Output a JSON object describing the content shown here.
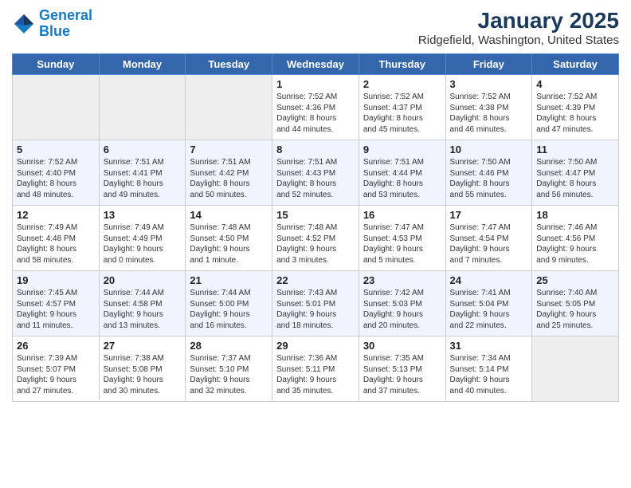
{
  "logo": {
    "line1": "General",
    "line2": "Blue"
  },
  "title": "January 2025",
  "subtitle": "Ridgefield, Washington, United States",
  "days_of_week": [
    "Sunday",
    "Monday",
    "Tuesday",
    "Wednesday",
    "Thursday",
    "Friday",
    "Saturday"
  ],
  "weeks": [
    {
      "days": [
        {
          "num": "",
          "info": ""
        },
        {
          "num": "",
          "info": ""
        },
        {
          "num": "",
          "info": ""
        },
        {
          "num": "1",
          "info": "Sunrise: 7:52 AM\nSunset: 4:36 PM\nDaylight: 8 hours\nand 44 minutes."
        },
        {
          "num": "2",
          "info": "Sunrise: 7:52 AM\nSunset: 4:37 PM\nDaylight: 8 hours\nand 45 minutes."
        },
        {
          "num": "3",
          "info": "Sunrise: 7:52 AM\nSunset: 4:38 PM\nDaylight: 8 hours\nand 46 minutes."
        },
        {
          "num": "4",
          "info": "Sunrise: 7:52 AM\nSunset: 4:39 PM\nDaylight: 8 hours\nand 47 minutes."
        }
      ]
    },
    {
      "days": [
        {
          "num": "5",
          "info": "Sunrise: 7:52 AM\nSunset: 4:40 PM\nDaylight: 8 hours\nand 48 minutes."
        },
        {
          "num": "6",
          "info": "Sunrise: 7:51 AM\nSunset: 4:41 PM\nDaylight: 8 hours\nand 49 minutes."
        },
        {
          "num": "7",
          "info": "Sunrise: 7:51 AM\nSunset: 4:42 PM\nDaylight: 8 hours\nand 50 minutes."
        },
        {
          "num": "8",
          "info": "Sunrise: 7:51 AM\nSunset: 4:43 PM\nDaylight: 8 hours\nand 52 minutes."
        },
        {
          "num": "9",
          "info": "Sunrise: 7:51 AM\nSunset: 4:44 PM\nDaylight: 8 hours\nand 53 minutes."
        },
        {
          "num": "10",
          "info": "Sunrise: 7:50 AM\nSunset: 4:46 PM\nDaylight: 8 hours\nand 55 minutes."
        },
        {
          "num": "11",
          "info": "Sunrise: 7:50 AM\nSunset: 4:47 PM\nDaylight: 8 hours\nand 56 minutes."
        }
      ]
    },
    {
      "days": [
        {
          "num": "12",
          "info": "Sunrise: 7:49 AM\nSunset: 4:48 PM\nDaylight: 8 hours\nand 58 minutes."
        },
        {
          "num": "13",
          "info": "Sunrise: 7:49 AM\nSunset: 4:49 PM\nDaylight: 9 hours\nand 0 minutes."
        },
        {
          "num": "14",
          "info": "Sunrise: 7:48 AM\nSunset: 4:50 PM\nDaylight: 9 hours\nand 1 minute."
        },
        {
          "num": "15",
          "info": "Sunrise: 7:48 AM\nSunset: 4:52 PM\nDaylight: 9 hours\nand 3 minutes."
        },
        {
          "num": "16",
          "info": "Sunrise: 7:47 AM\nSunset: 4:53 PM\nDaylight: 9 hours\nand 5 minutes."
        },
        {
          "num": "17",
          "info": "Sunrise: 7:47 AM\nSunset: 4:54 PM\nDaylight: 9 hours\nand 7 minutes."
        },
        {
          "num": "18",
          "info": "Sunrise: 7:46 AM\nSunset: 4:56 PM\nDaylight: 9 hours\nand 9 minutes."
        }
      ]
    },
    {
      "days": [
        {
          "num": "19",
          "info": "Sunrise: 7:45 AM\nSunset: 4:57 PM\nDaylight: 9 hours\nand 11 minutes."
        },
        {
          "num": "20",
          "info": "Sunrise: 7:44 AM\nSunset: 4:58 PM\nDaylight: 9 hours\nand 13 minutes."
        },
        {
          "num": "21",
          "info": "Sunrise: 7:44 AM\nSunset: 5:00 PM\nDaylight: 9 hours\nand 16 minutes."
        },
        {
          "num": "22",
          "info": "Sunrise: 7:43 AM\nSunset: 5:01 PM\nDaylight: 9 hours\nand 18 minutes."
        },
        {
          "num": "23",
          "info": "Sunrise: 7:42 AM\nSunset: 5:03 PM\nDaylight: 9 hours\nand 20 minutes."
        },
        {
          "num": "24",
          "info": "Sunrise: 7:41 AM\nSunset: 5:04 PM\nDaylight: 9 hours\nand 22 minutes."
        },
        {
          "num": "25",
          "info": "Sunrise: 7:40 AM\nSunset: 5:05 PM\nDaylight: 9 hours\nand 25 minutes."
        }
      ]
    },
    {
      "days": [
        {
          "num": "26",
          "info": "Sunrise: 7:39 AM\nSunset: 5:07 PM\nDaylight: 9 hours\nand 27 minutes."
        },
        {
          "num": "27",
          "info": "Sunrise: 7:38 AM\nSunset: 5:08 PM\nDaylight: 9 hours\nand 30 minutes."
        },
        {
          "num": "28",
          "info": "Sunrise: 7:37 AM\nSunset: 5:10 PM\nDaylight: 9 hours\nand 32 minutes."
        },
        {
          "num": "29",
          "info": "Sunrise: 7:36 AM\nSunset: 5:11 PM\nDaylight: 9 hours\nand 35 minutes."
        },
        {
          "num": "30",
          "info": "Sunrise: 7:35 AM\nSunset: 5:13 PM\nDaylight: 9 hours\nand 37 minutes."
        },
        {
          "num": "31",
          "info": "Sunrise: 7:34 AM\nSunset: 5:14 PM\nDaylight: 9 hours\nand 40 minutes."
        },
        {
          "num": "",
          "info": ""
        }
      ]
    }
  ]
}
